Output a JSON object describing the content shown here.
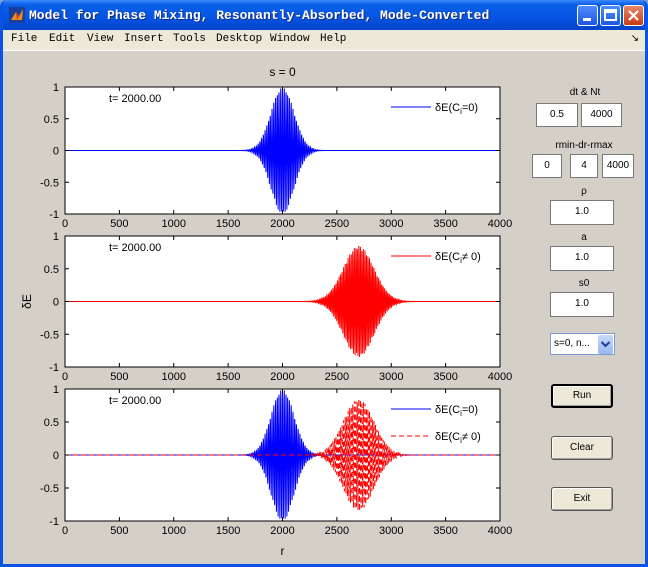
{
  "window": {
    "title": "Model for Phase Mixing, Resonantly-Absorbed, Mode-Converted"
  },
  "menubar": {
    "items": [
      "File",
      "Edit",
      "View",
      "Insert",
      "Tools",
      "Desktop",
      "Window",
      "Help"
    ],
    "corner_icon": "dock-arrow-icon"
  },
  "figure": {
    "title": "s = 0",
    "ylabel": "δE",
    "xlabel": "r"
  },
  "controls": {
    "dt_nt_label": "dt & Nt",
    "dt_value": "0.5",
    "nt_value": "4000",
    "rrange_label": "rmin-dr-rmax",
    "rmin_value": "0",
    "dr_value": "4",
    "rmax_value": "4000",
    "rho_label": "ρ",
    "rho_value": "1.0",
    "a_label": "a",
    "a_value": "1.0",
    "s0_label": "s0",
    "s0_value": "1.0",
    "mode_value": "s=0, n...",
    "run_label": "Run",
    "clear_label": "Clear",
    "exit_label": "Exit"
  },
  "chart_data": [
    {
      "type": "line",
      "time_annotation": "t= 2000.00",
      "xlim": [
        0,
        4000
      ],
      "ylim": [
        -1,
        1
      ],
      "xticks": [
        0,
        500,
        1000,
        1500,
        2000,
        2500,
        3000,
        3500,
        4000
      ],
      "yticks": [
        1,
        0.5,
        0,
        -0.5,
        -1
      ],
      "legend_placement": "top-right",
      "series": [
        {
          "name": "δE(Ci=0)",
          "color": "#0000ff",
          "style": "solid",
          "packet_center": 2000,
          "packet_width": 150,
          "amplitude": 1.0,
          "wavelength": 16
        }
      ]
    },
    {
      "type": "line",
      "time_annotation": "t= 2000.00",
      "xlim": [
        0,
        4000
      ],
      "ylim": [
        -1,
        1
      ],
      "xticks": [
        0,
        500,
        1000,
        1500,
        2000,
        2500,
        3000,
        3500,
        4000
      ],
      "yticks": [
        1,
        0.5,
        0,
        -0.5,
        -1
      ],
      "legend_placement": "top-right",
      "series": [
        {
          "name": "δE(Ci≠ 0)",
          "color": "#ff0000",
          "style": "solid",
          "packet_center": 2700,
          "packet_width": 200,
          "amplitude": 0.85,
          "wavelength": 14
        }
      ]
    },
    {
      "type": "line",
      "time_annotation": "t= 2000.00",
      "xlim": [
        0,
        4000
      ],
      "ylim": [
        -1,
        1
      ],
      "xticks": [
        0,
        500,
        1000,
        1500,
        2000,
        2500,
        3000,
        3500,
        4000
      ],
      "yticks": [
        1,
        0.5,
        0,
        -0.5,
        -1
      ],
      "legend_placement": "top-right",
      "series": [
        {
          "name": "δE(Ci=0)",
          "color": "#0000ff",
          "style": "solid",
          "packet_center": 2000,
          "packet_width": 150,
          "amplitude": 1.0,
          "wavelength": 16
        },
        {
          "name": "δE(Ci≠ 0)",
          "color": "#ff0000",
          "style": "dashed",
          "packet_center": 2700,
          "packet_width": 200,
          "amplitude": 0.85,
          "wavelength": 14
        }
      ]
    }
  ]
}
